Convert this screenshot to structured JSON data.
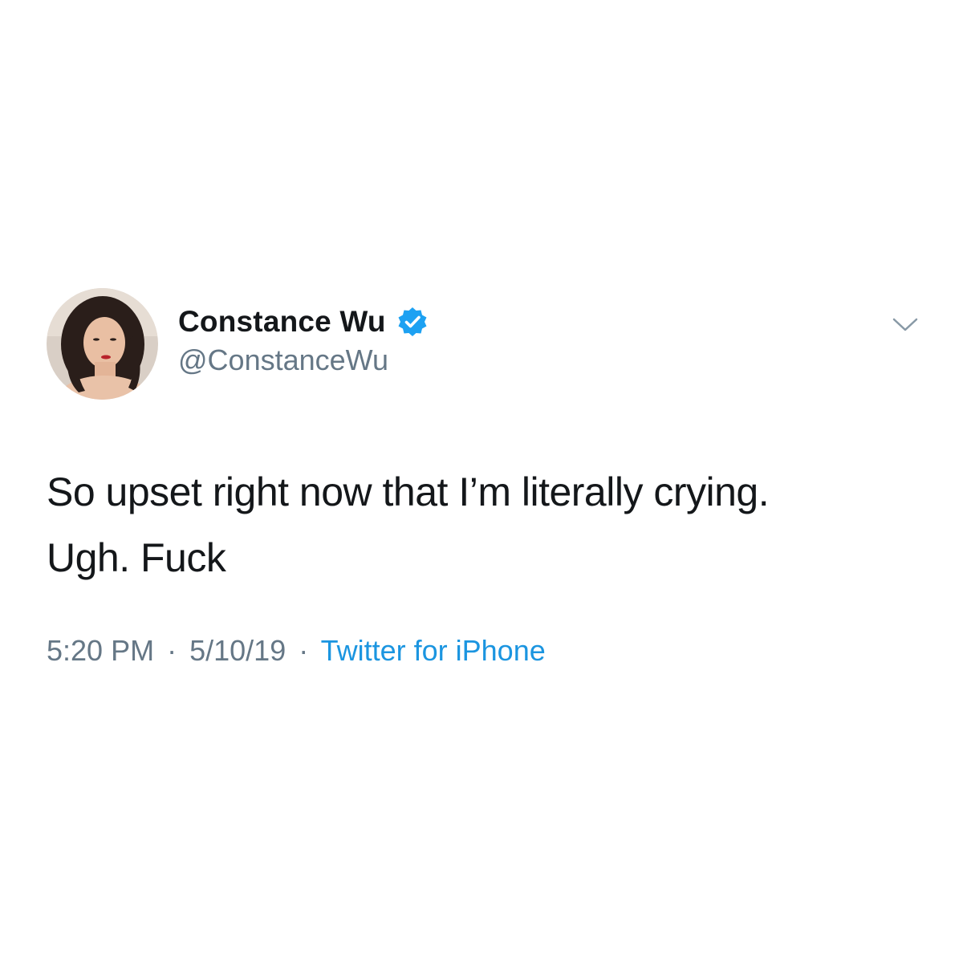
{
  "author": {
    "display_name": "Constance Wu",
    "handle": "@ConstanceWu",
    "verified": true,
    "avatar_icon": "profile-photo"
  },
  "tweet": {
    "lines": [
      "So upset right now that I’m literally crying.",
      "Ugh. Fuck"
    ]
  },
  "meta": {
    "time": "5:20 PM",
    "date": "5/10/19",
    "separator": "·",
    "source": "Twitter for iPhone"
  },
  "menu": {
    "icon": "chevron-down-icon"
  },
  "colors": {
    "text": "#14171a",
    "secondary": "#657786",
    "link": "#1b95e0",
    "verified": "#1da1f2"
  }
}
